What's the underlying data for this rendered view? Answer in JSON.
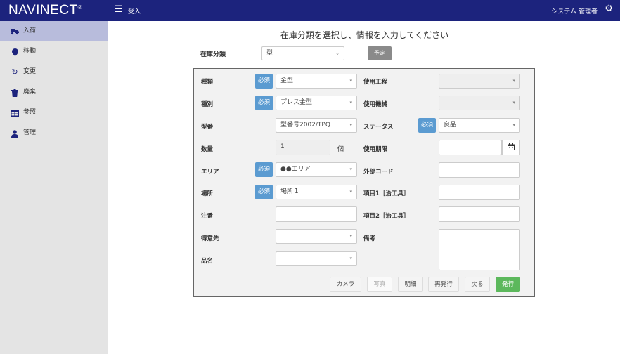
{
  "header": {
    "brand": "NAVINECT",
    "brand_mark": "®",
    "menu_icon": "hamburger-icon",
    "title": "受入",
    "user": "システム 管理者",
    "settings_icon": "gear-icon",
    "bg_color": "#1c237d"
  },
  "sidebar": {
    "items": [
      {
        "label": "入荷",
        "icon": "truck-icon",
        "active": true
      },
      {
        "label": "移動",
        "icon": "map-marker-icon",
        "active": false
      },
      {
        "label": "変更",
        "icon": "refresh-icon",
        "active": false
      },
      {
        "label": "廃棄",
        "icon": "trash-icon",
        "active": false
      },
      {
        "label": "参照",
        "icon": "table-icon",
        "active": false
      },
      {
        "label": "管理",
        "icon": "user-icon",
        "active": false
      }
    ]
  },
  "main": {
    "heading": "在庫分類を選択し、情報を入力してください",
    "category_label": "在庫分類",
    "category_value": "型",
    "plan_button": "予定"
  },
  "form": {
    "required_label": "必須",
    "kind": {
      "label": "種類",
      "value": "金型"
    },
    "type": {
      "label": "種別",
      "value": "プレス金型"
    },
    "model_no": {
      "label": "型番",
      "value": "型番号2002/TPQ"
    },
    "quantity": {
      "label": "数量",
      "value": "1",
      "unit": "個"
    },
    "area": {
      "label": "エリア",
      "value": "●●エリア"
    },
    "location": {
      "label": "場所",
      "value": "場所１"
    },
    "order_no": {
      "label": "注番",
      "value": ""
    },
    "customer": {
      "label": "得意先",
      "value": ""
    },
    "product_name": {
      "label": "品名",
      "value": ""
    },
    "process": {
      "label": "使用工程",
      "value": ""
    },
    "machine": {
      "label": "使用機械",
      "value": ""
    },
    "status": {
      "label": "ステータス",
      "value": "良品"
    },
    "expiry": {
      "label": "使用期限",
      "value": "",
      "icon": "calendar-icon"
    },
    "external_code": {
      "label": "外部コード",
      "value": ""
    },
    "item1": {
      "label": "項目1［治工具］",
      "value": ""
    },
    "item2": {
      "label": "項目2［治工具］",
      "value": ""
    },
    "remarks": {
      "label": "備考",
      "value": ""
    }
  },
  "buttons": {
    "camera": "カメラ",
    "photo": "写真",
    "details": "明細",
    "reissue": "再発行",
    "back": "戻る",
    "issue": "発行"
  }
}
